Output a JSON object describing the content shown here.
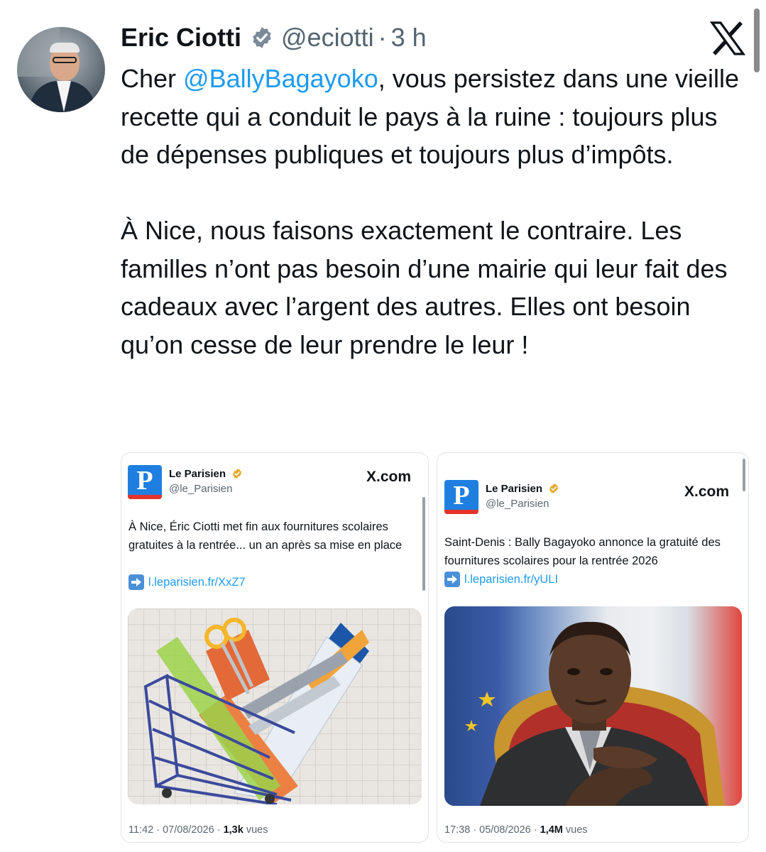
{
  "tweet": {
    "author_name": "Eric Ciotti",
    "handle": "@eciotti",
    "separator": "·",
    "time": "3 h",
    "text_before_mention": "Cher ",
    "mention": "@BallyBagayoko",
    "text_after_mention": ", vous persistez dans une vieille recette qui a conduit le pays à la ruine : toujours plus de dépenses publiques et toujours plus d’impôts.\n\nÀ Nice, nous faisons exactement le contraire. Les familles n’ont pas besoin d’une mairie qui leur fait des cadeaux avec l’argent des autres. Elles ont besoin qu’on cesse de leur prendre le leur !"
  },
  "cards": [
    {
      "account_name": "Le Parisien",
      "account_handle": "@le_Parisien",
      "source": "X.com",
      "body": "À Nice, Éric Ciotti met fin aux fournitures scolaires gratuites à la rentrée... un an après sa mise en place",
      "link": "l.leparisien.fr/XxZ7",
      "timestamp": "11:42 · 07/08/2026 · ",
      "views_count": "1,3k",
      "views_label": " vues"
    },
    {
      "account_name": "Le Parisien",
      "account_handle": "@le_Parisien",
      "source": "X.com",
      "body": "Saint-Denis : Bally Bagayoko annonce la gratuité des fournitures scolaires pour la rentrée 2026",
      "link": "l.leparisien.fr/yULI",
      "timestamp": "17:38 · 05/08/2026 · ",
      "views_count": "1,4M",
      "views_label": " vues"
    }
  ],
  "logo_letter": "P",
  "colors": {
    "link_blue": "#1d9bf0",
    "verified_blue": "#7b8a99",
    "gold_badge": "#e3a92c",
    "parisien_blue": "#1f7fe0",
    "parisien_red": "#e6332a"
  },
  "icons": [
    "verified-badge-icon",
    "x-logo-icon",
    "gold-verified-icon",
    "link-arrow-icon"
  ]
}
